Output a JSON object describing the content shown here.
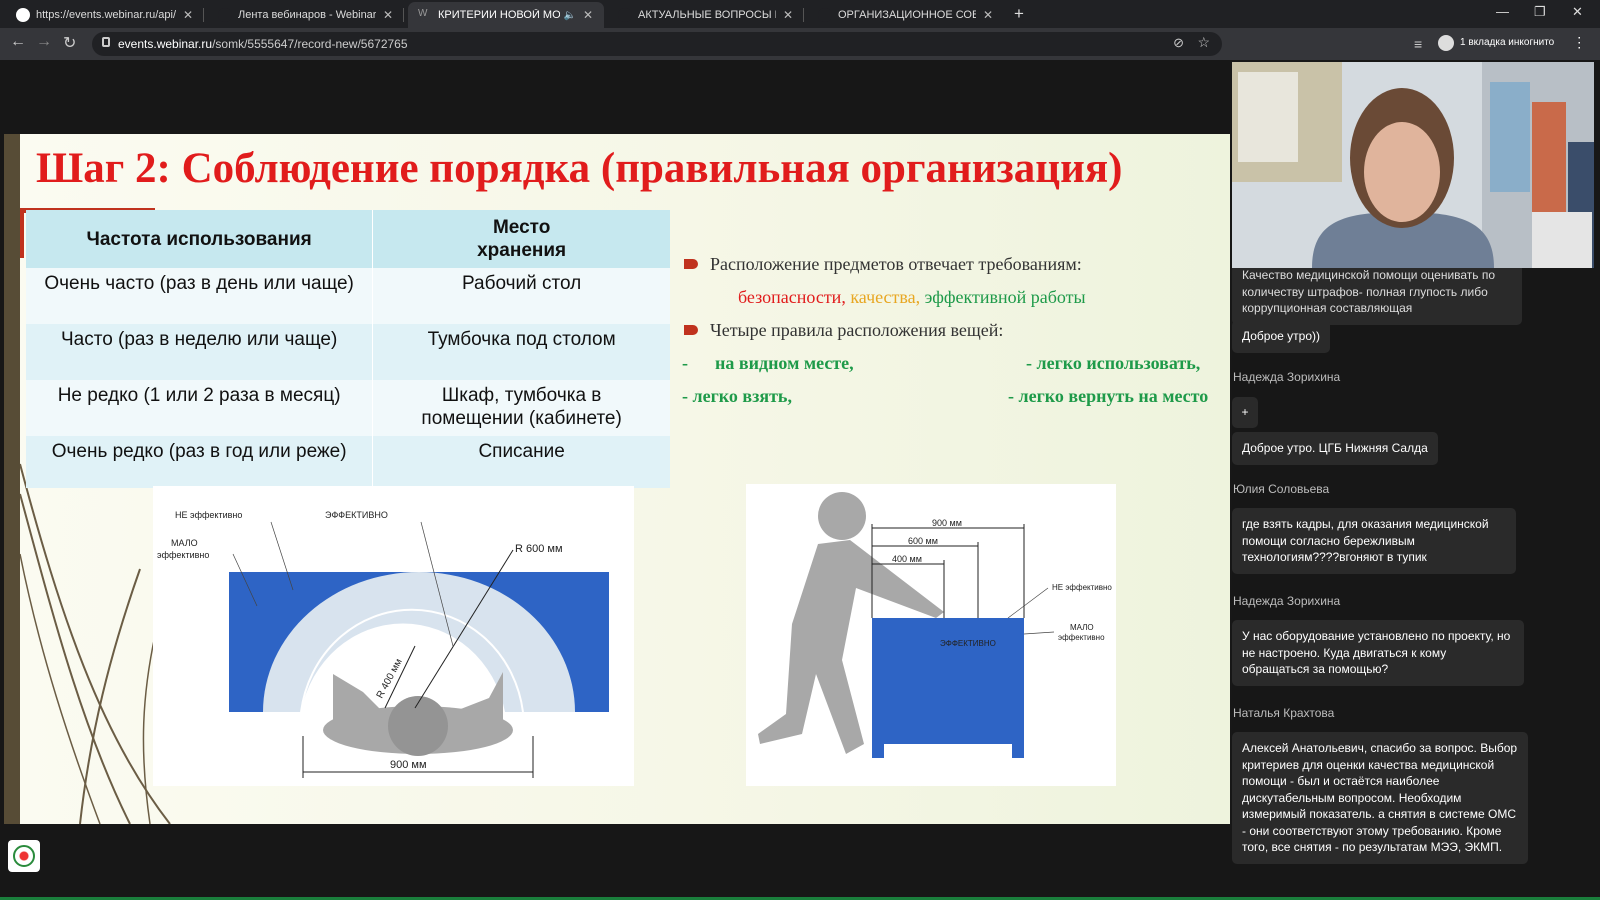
{
  "browser": {
    "tabs": [
      {
        "title": "https://events.webinar.ru/api/log",
        "active": false
      },
      {
        "title": "Лента вебинаров - Webinar",
        "active": false
      },
      {
        "title": "КРИТЕРИИ НОВОЙ МОДЕЛ",
        "active": true
      },
      {
        "title": "АКТУАЛЬНЫЕ ВОПРОСЫ ПЕДИ",
        "active": false
      },
      {
        "title": "ОРГАНИЗАЦИОННОЕ СОБРАН",
        "active": false
      }
    ],
    "url_host": "events.webinar.ru",
    "url_path": "/somk/5555647/record-new/5672765",
    "incognito_label": "1 вкладка инкогнито"
  },
  "slide": {
    "title": "Шаг 2: Соблюдение порядка (правильная организация)",
    "table": {
      "headers": [
        "Частота использования",
        "Место хранения"
      ],
      "rows": [
        [
          "Очень часто (раз в день или чаще)",
          "Рабочий стол"
        ],
        [
          "Часто (раз в неделю или чаще)",
          "Тумбочка под столом"
        ],
        [
          "Не редко (1 или 2 раза в месяц)",
          "Шкаф, тумбочка в помещении (кабинете)"
        ],
        [
          "Очень редко (раз в год или реже)",
          "Списание"
        ]
      ]
    },
    "bullets": {
      "b1": "Расположение предметов отвечает требованиям:",
      "req_safety": "безопасности,",
      "req_quality": "качества,",
      "req_efficiency": "эффективной работы",
      "b2": "Четыре правила расположения вещей:",
      "r1": "-      на видном месте,",
      "r2": "- легко использовать,",
      "r3": "- легко взять,",
      "r4": "- легко вернуть на место"
    },
    "diagram_top": {
      "label_not_eff": "НЕ эффективно",
      "label_eff": "ЭФФЕКТИВНО",
      "label_low": "МАЛО",
      "label_low2": "эффективно",
      "r600": "R 600 мм",
      "r400": "R 400 мм",
      "w900": "900 мм"
    },
    "diagram_side": {
      "d900": "900 мм",
      "d600": "600 мм",
      "d400": "400 мм",
      "not_eff": "НЕ эффективно",
      "low": "МАЛО",
      "low2": "эффективно",
      "eff": "ЭФФЕКТИВНО"
    }
  },
  "chat": {
    "messages": [
      {
        "author": "",
        "text": "Качество медицинской помощи оценивать по количеству штрафов- полная глупость либо коррупционная составляющая"
      },
      {
        "author": "",
        "text": "Доброе утро))"
      },
      {
        "author": "Надежда Зорихина",
        "text": "+"
      },
      {
        "author": "",
        "text": "Доброе утро.  ЦГБ Нижняя Салда"
      },
      {
        "author": "Юлия Соловьева",
        "text": "где взять кадры, для оказания медицинской помощи согласно бережливым технологиям????вгоняют в тупик"
      },
      {
        "author": "Надежда Зорихина",
        "text": "У нас оборудование установлено по проекту, но не настроено. Куда двигаться к кому обращаться за помощью?"
      },
      {
        "author": "Наталья Крахтова",
        "text": "Алексей Анатольевич, спасибо за вопрос. Выбор критериев для оценки качества медицинской помощи - был и остаётся наиболее дискутабельным вопросом. Необходим измеримый показатель. а снятия в системе ОМС - они соответствуют этому требованию. Кроме того,  все снятия - по результатам МЭЭ, ЭКМП."
      }
    ]
  },
  "colors": {
    "slide_title": "#e11c1c",
    "table_header": "#c6e8ef",
    "rules_green": "#1e9a49",
    "diagram_blue": "#2e64c5"
  }
}
